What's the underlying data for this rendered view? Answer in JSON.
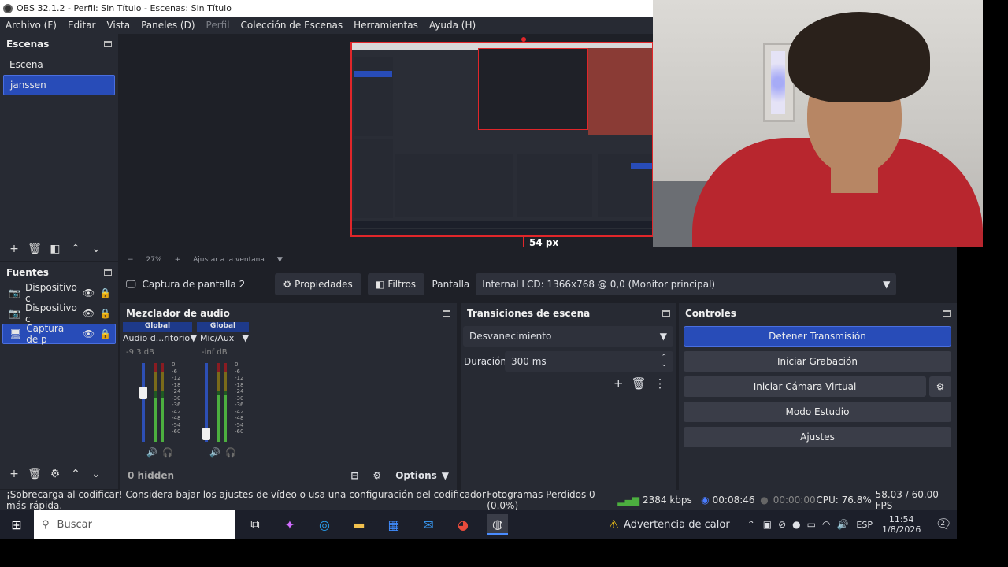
{
  "window": {
    "title": "OBS 32.1.2 - Perfil: Sin Título - Escenas: Sin Título"
  },
  "menu": [
    "Archivo (F)",
    "Editar",
    "Vista",
    "Paneles (D)",
    "Perfil",
    "Colección de Escenas",
    "Herramientas",
    "Ayuda (H)"
  ],
  "scenes": {
    "title": "Escenas",
    "items": [
      "Escena",
      "janssen"
    ],
    "selected": 1
  },
  "sources": {
    "title": "Fuentes",
    "items": [
      "Dispositivo c",
      "Dispositivo c",
      "Captura de p"
    ],
    "selected": 2
  },
  "preview": {
    "zoom": "27%",
    "fit_label": "Ajustar a la ventana",
    "px_label": "54 px"
  },
  "source_bar": {
    "name": "Captura de pantalla 2",
    "props": "Propiedades",
    "filters": "Filtros",
    "screen_label": "Pantalla",
    "screen_value": "Internal LCD: 1366x768 @ 0,0 (Monitor principal)"
  },
  "mixer": {
    "title": "Mezclador de audio",
    "channels": [
      {
        "tag": "Global",
        "name": "Audio d...ritorio",
        "db": "-9.3 dB",
        "level": 0.62
      },
      {
        "tag": "Global",
        "name": "Mic/Aux",
        "db": "-inf dB",
        "level": 0.1
      }
    ],
    "scale": [
      "0",
      "-6",
      "-12",
      "-18",
      "-24",
      "-30",
      "-36",
      "-42",
      "-48",
      "-54",
      "-60"
    ],
    "hidden": "0 hidden",
    "options": "Options"
  },
  "transitions": {
    "title": "Transiciones de escena",
    "selected": "Desvanecimiento",
    "duration_label": "Duración",
    "duration": "300 ms"
  },
  "controls": {
    "title": "Controles",
    "stream": "Detener Transmisión",
    "record": "Iniciar Grabación",
    "vcam": "Iniciar Cámara Virtual",
    "studio": "Modo Estudio",
    "settings": "Ajustes"
  },
  "status": {
    "warning": "¡Sobrecarga al codificar! Considera bajar los ajustes de vídeo o usa una configuración del codificador más rápida.",
    "dropped": "Fotogramas Perdidos 0 (0.0%)",
    "bitrate": "2384 kbps",
    "stream_time": "00:08:46",
    "rec_time": "00:00:00",
    "cpu": "CPU: 76.8%",
    "fps": "58.03 / 60.00 FPS"
  },
  "taskbar": {
    "search": "Buscar",
    "heat": "Advertencia de calor",
    "lang": "ESP",
    "time": "11:54",
    "date": "1/8/2026",
    "notif": "2"
  },
  "colors": {
    "accent": "#284cb8",
    "red": "#e0262a",
    "green": "#4caf3f"
  }
}
